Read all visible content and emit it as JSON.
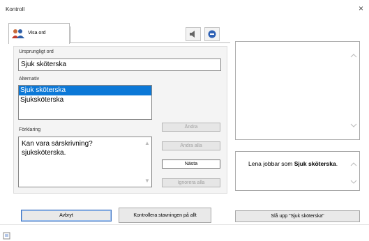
{
  "window": {
    "title": "Kontroll",
    "close_glyph": "×"
  },
  "tab": {
    "label": "Visa ord",
    "icon": "users-icon"
  },
  "toolbar": {
    "speaker_icon": "speaker-icon",
    "stop_icon": "stop-icon"
  },
  "original": {
    "label": "Ursprungligt ord",
    "value": "Sjuk sköterska"
  },
  "alternatives": {
    "label": "Alternativ",
    "items": [
      "Sjuk sköterska",
      "Sjuksköterska"
    ],
    "selected_index": 0
  },
  "explanation": {
    "label": "Förklaring",
    "text_line1": "Kan vara särskrivning?",
    "text_line2": "sjuksköterska."
  },
  "buttons": {
    "change": "Ändra",
    "change_all": "Ändra alla",
    "next": "Nästa",
    "ignore_all": "Ignorera alla"
  },
  "preview": {
    "prefix": "Lena jobbar som ",
    "bold1": "Sjuk",
    "bold2": "sköterska",
    "suffix": "."
  },
  "bottom": {
    "cancel": "Avbryt",
    "check_spelling": "Kontrollera stavningen på allt",
    "lookup": "Slå upp \"Sjuk sköterska\""
  },
  "colors": {
    "selection": "#0b78d7",
    "focus_border": "#3a6fbf"
  }
}
